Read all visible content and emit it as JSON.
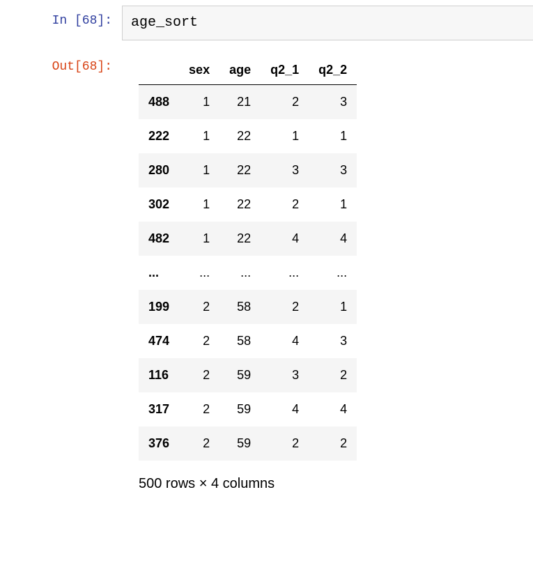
{
  "in_prompt": "In [68]:",
  "out_prompt": "Out[68]:",
  "code": "age_sort",
  "df": {
    "columns": [
      "sex",
      "age",
      "q2_1",
      "q2_2"
    ],
    "index_name": "",
    "rows": [
      {
        "idx": "488",
        "vals": [
          "1",
          "21",
          "2",
          "3"
        ]
      },
      {
        "idx": "222",
        "vals": [
          "1",
          "22",
          "1",
          "1"
        ]
      },
      {
        "idx": "280",
        "vals": [
          "1",
          "22",
          "3",
          "3"
        ]
      },
      {
        "idx": "302",
        "vals": [
          "1",
          "22",
          "2",
          "1"
        ]
      },
      {
        "idx": "482",
        "vals": [
          "1",
          "22",
          "4",
          "4"
        ]
      },
      {
        "idx": "...",
        "vals": [
          "...",
          "...",
          "...",
          "..."
        ]
      },
      {
        "idx": "199",
        "vals": [
          "2",
          "58",
          "2",
          "1"
        ]
      },
      {
        "idx": "474",
        "vals": [
          "2",
          "58",
          "4",
          "3"
        ]
      },
      {
        "idx": "116",
        "vals": [
          "2",
          "59",
          "3",
          "2"
        ]
      },
      {
        "idx": "317",
        "vals": [
          "2",
          "59",
          "4",
          "4"
        ]
      },
      {
        "idx": "376",
        "vals": [
          "2",
          "59",
          "2",
          "2"
        ]
      }
    ],
    "summary": "500 rows × 4 columns"
  }
}
